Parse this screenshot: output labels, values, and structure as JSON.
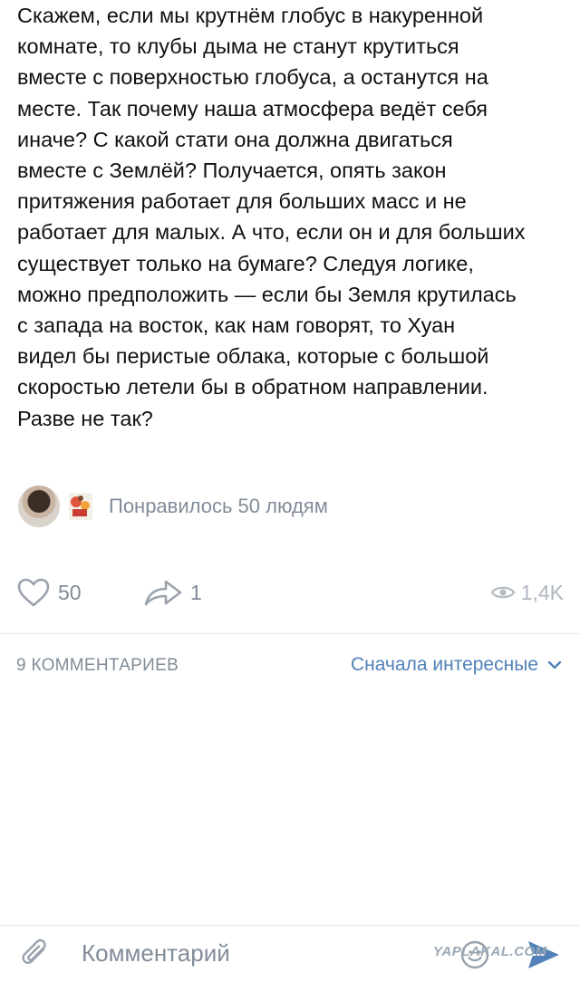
{
  "post": {
    "lines": [
      "Скажем, если мы крутнём глобус в накуренной",
      "комнате, то клубы дыма не станут крутиться",
      "вместе с поверхностью глобуса, а останутся на",
      "месте. Так почему наша атмосфера ведёт себя",
      "иначе? С какой стати она должна двигаться",
      "вместе с Землёй? Получается, опять закон",
      "притяжения работает для больших масс и не",
      "работает для малых. А что, если он и для больших",
      "существует только на бумаге? Следуя логике,",
      "можно предположить — если бы Земля крутилась",
      "с запада на восток, как нам говорят, то Хуан",
      "видел бы перистые облака, которые с большой",
      "скоростью летели бы в обратном направлении.",
      "Разве не так?"
    ]
  },
  "likes": {
    "liked_by_text": "Понравилось 50 людям"
  },
  "actions": {
    "like_count": "50",
    "share_count": "1",
    "views_count": "1,4K"
  },
  "comments": {
    "count_label": "9 КОММЕНТАРИЕВ",
    "sort_label": "Сначала интересные"
  },
  "composer": {
    "placeholder": "Комментарий"
  },
  "watermark": "YAPLAKAL.COM",
  "colors": {
    "accent": "#5181b8",
    "muted": "#818c99",
    "divider": "#e7e8ec"
  },
  "icons": {
    "like": "heart-icon",
    "share": "share-arrow-icon",
    "views": "eye-icon",
    "sort": "chevron-down-icon",
    "attach": "paperclip-icon",
    "emoji": "smile-icon",
    "send": "send-icon"
  }
}
